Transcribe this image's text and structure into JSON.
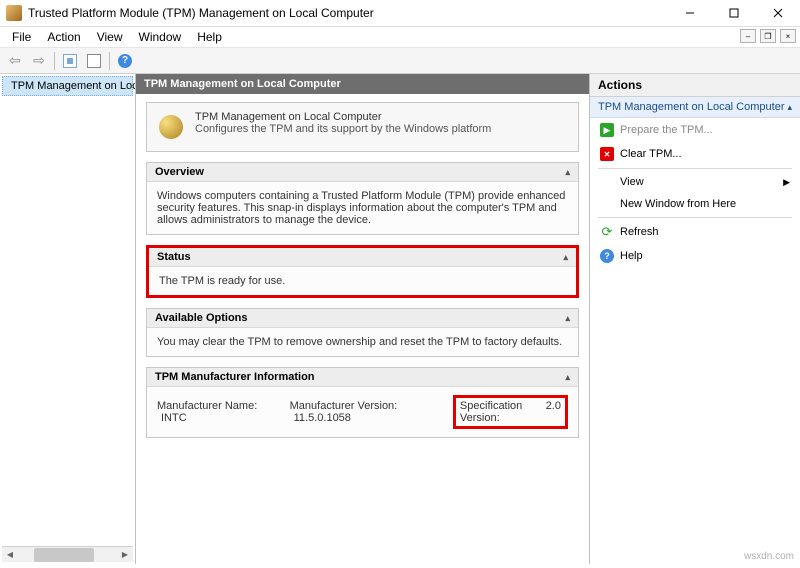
{
  "window": {
    "title": "Trusted Platform Module (TPM) Management on Local Computer"
  },
  "menu": {
    "file": "File",
    "action": "Action",
    "view": "View",
    "window": "Window",
    "help": "Help"
  },
  "tree": {
    "root": "TPM Management on Local"
  },
  "mid": {
    "header": "TPM Management on Local Computer",
    "intro_title": "TPM Management on Local Computer",
    "intro_desc": "Configures the TPM and its support by the Windows platform"
  },
  "sections": {
    "overview": {
      "title": "Overview",
      "body": "Windows computers containing a Trusted Platform Module (TPM) provide enhanced security features. This snap-in displays information about the computer's TPM and allows administrators to manage the device."
    },
    "status": {
      "title": "Status",
      "body": "The TPM is ready for use."
    },
    "options": {
      "title": "Available Options",
      "body": "You may clear the TPM to remove ownership and reset the TPM to factory defaults."
    },
    "manufacturer": {
      "title": "TPM Manufacturer Information",
      "name_label": "Manufacturer Name:",
      "name_value": "INTC",
      "ver_label": "Manufacturer Version:",
      "ver_value": "11.5.0.1058",
      "spec_label": "Specification Version:",
      "spec_value": "2.0"
    }
  },
  "actions": {
    "pane_title": "Actions",
    "group_title": "TPM Management on Local Computer",
    "prepare": "Prepare the TPM...",
    "clear": "Clear TPM...",
    "view": "View",
    "new_window": "New Window from Here",
    "refresh": "Refresh",
    "help": "Help"
  },
  "watermark": "wsxdn.com"
}
